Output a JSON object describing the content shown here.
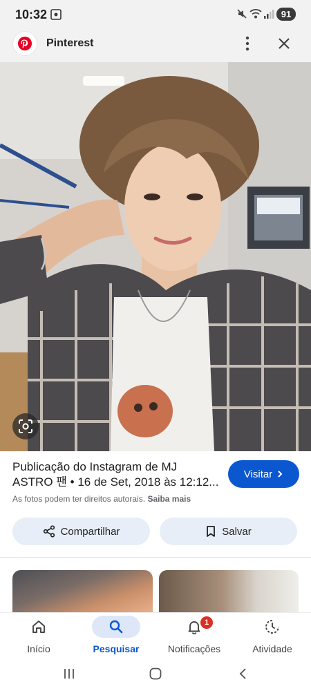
{
  "status_bar": {
    "time": "10:32",
    "battery": "91"
  },
  "header": {
    "site_name": "Pinterest",
    "icons": [
      "pinterest-logo-icon",
      "more-vert-icon",
      "close-icon"
    ]
  },
  "image": {
    "alt": "",
    "lens_icon": "google-lens-icon"
  },
  "result": {
    "title_line1": "Publicação do Instagram de MJ",
    "title_line2": "ASTRO 팬 • 16 de Set, 2018 às 12:12...",
    "visit_label": "Visitar",
    "copyright_text": "As fotos podem ter direitos autorais.",
    "copyright_link": "Saiba mais"
  },
  "actions": {
    "share_label": "Compartilhar",
    "save_label": "Salvar"
  },
  "bottom_nav": {
    "items": [
      {
        "label": "Início",
        "icon": "home-icon"
      },
      {
        "label": "Pesquisar",
        "icon": "search-icon"
      },
      {
        "label": "Notificações",
        "icon": "bell-icon",
        "badge": "1"
      },
      {
        "label": "Atividade",
        "icon": "activity-icon"
      }
    ],
    "active": "Pesquisar"
  },
  "colors": {
    "accent": "#0b57d0",
    "action_bg": "#e8eef7",
    "badge": "#d93025",
    "pinterest": "#e60023"
  }
}
